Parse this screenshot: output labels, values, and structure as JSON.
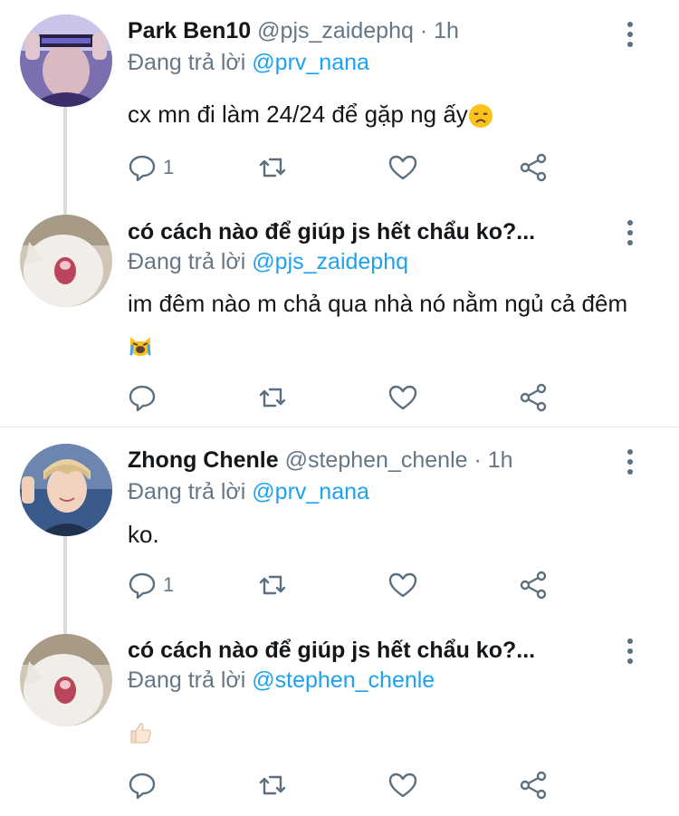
{
  "colors": {
    "accent": "#1da1f2",
    "muted": "#657786",
    "text": "#14171a",
    "line": "#e1e8ed"
  },
  "tweets": [
    {
      "name": "Park Ben10",
      "handle": "@pjs_zaidephq",
      "time": "1h",
      "reply_prefix": "Đang trả lời",
      "reply_to": "@prv_nana",
      "text": "cx mn đi làm 24/24 để gặp ng ấy",
      "emoji": "disappointed-face",
      "reply_count": "1"
    },
    {
      "name": "có cách nào để giúp js hết chẩu ko?...",
      "reply_prefix": "Đang trả lời",
      "reply_to": "@pjs_zaidephq",
      "text": "im đêm nào m chả qua nhà nó nằm ngủ cả đêm",
      "emoji": "crying-cat-face",
      "reply_count": ""
    },
    {
      "name": "Zhong Chenle",
      "handle": "@stephen_chenle",
      "time": "1h",
      "reply_prefix": "Đang trả lời",
      "reply_to": "@prv_nana",
      "text": "ko.",
      "reply_count": "1"
    },
    {
      "name": "có cách nào để giúp js hết chẩu ko?...",
      "reply_prefix": "Đang trả lời",
      "reply_to": "@stephen_chenle",
      "text": "",
      "emoji": "thumbs-up",
      "reply_count": ""
    }
  ],
  "separator": "·"
}
